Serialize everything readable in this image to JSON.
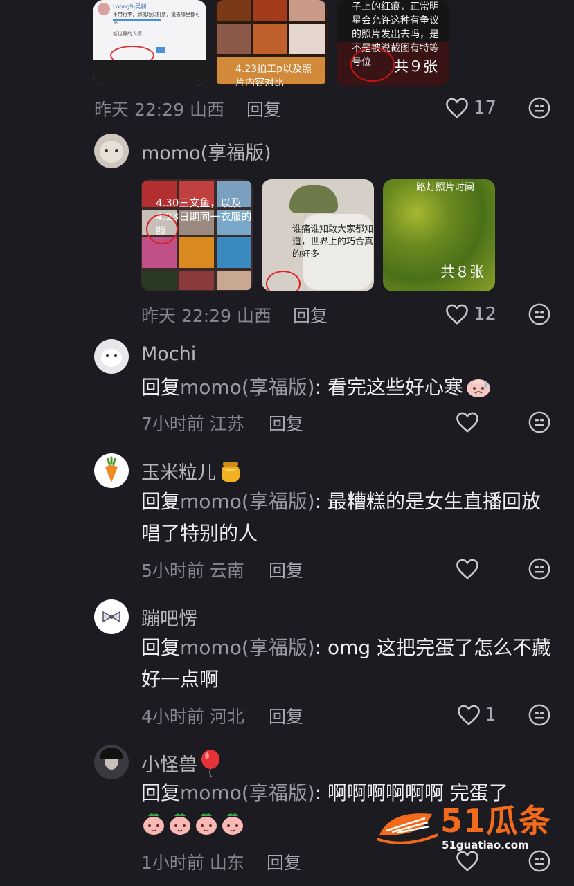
{
  "comment_top": {
    "thumbs": [
      {
        "caption": [
          "Loong9-吴刹",
          "不带行李，到机场买机票，说去哪里都可以",
          "新世界的人情"
        ]
      },
      {
        "caption": "4.23拍工p以及照片内容对比"
      },
      {
        "caption": "子上的红痕，正常明星会允许这种有争议的照片发出去吗，是不是被说截图有特等号位",
        "count": "共９张"
      }
    ],
    "time": "昨天 22:29 山西",
    "reply": "回复",
    "likes": "17"
  },
  "comment_momo": {
    "user": "momo(享福版)",
    "thumbs": [
      {
        "caption": "4.30三文鱼，以及4.23日期同一衣服的照"
      },
      {
        "caption": "谁痛谁知敢大家都知道，世界上的巧合真的好多"
      },
      {
        "caption": "路灯照片时间",
        "count": "共８张"
      }
    ],
    "time": "昨天 22:29 山西",
    "reply": "回复",
    "likes": "12"
  },
  "replies": [
    {
      "user": "Mochi",
      "reply_prefix": "回复",
      "reply_to": "momo(享福版)",
      "text": ": 看完这些好心寒",
      "time": "7小时前 江苏",
      "reply": "回复",
      "likes": ""
    },
    {
      "user": "玉米粒儿",
      "reply_prefix": "回复",
      "reply_to": "momo(享福版)",
      "text": ": 最糟糕的是女生直播回放唱了特别的人",
      "time": "5小时前 云南",
      "reply": "回复",
      "likes": ""
    },
    {
      "user": "蹦吧愣",
      "reply_prefix": "回复",
      "reply_to": "momo(享福版)",
      "text": ": omg 这把完蛋了怎么不藏好一点啊",
      "time": "4小时前 河北",
      "reply": "回复",
      "likes": "1"
    },
    {
      "user": "小怪兽",
      "reply_prefix": "回复",
      "reply_to": "momo(享福版)",
      "text": ": 啊啊啊啊啊啊  完蛋了",
      "time": "1小时前 山东",
      "reply": "回复",
      "likes": ""
    }
  ],
  "watermark": {
    "brand": "51瓜条",
    "url": "51guatiao.com"
  },
  "colors": {
    "background": "#1b1b21",
    "text": "#eeeef1",
    "muted": "#86868f",
    "watermark": "#f26a1b"
  },
  "icons": [
    "heart-icon",
    "emoji-reaction-icon",
    "sad-emoji-icon",
    "honey-emoji-icon",
    "balloon-emoji-icon",
    "peach-emoji-icon"
  ]
}
